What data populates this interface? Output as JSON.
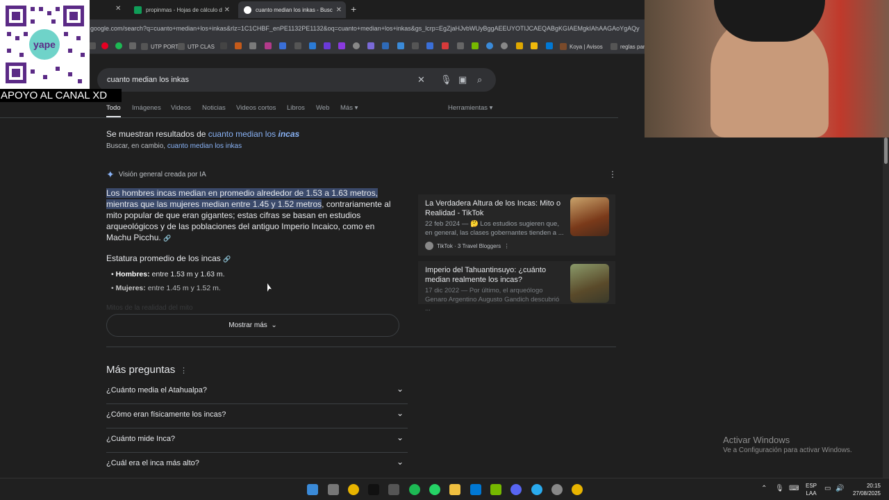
{
  "browser": {
    "tabs": [
      {
        "label": "propinmas - Hojas de cálculo d"
      },
      {
        "label": "cuanto median los inkas - Busc"
      }
    ],
    "url": "google.com/search?q=cuanto+median+los+inkas&rlz=1C1CHBF_enPE1132PE1132&oq=cuanto+median+los+inkas&gs_lcrp=EgZjaHJvbWUyBggAEEUYOTIJCAEQABgKGIAEMgkIAhAAGAoYgAQy",
    "bookmarks": [
      "UTP PORTAL",
      "UTP CLAS",
      "Koya | Avisos",
      "reglas par"
    ]
  },
  "search": {
    "query": "cuanto median los inkas"
  },
  "search_tabs": [
    "Todo",
    "Imágenes",
    "Videos",
    "Noticias",
    "Videos cortos",
    "Libros",
    "Web",
    "Más",
    "Herramientas"
  ],
  "spelling": {
    "prefix": "Se muestran resultados de ",
    "corrected": "cuanto median los ",
    "corrected_bold": "incas",
    "instead_prefix": "Buscar, en cambio, ",
    "instead_link": "cuanto median los inkas"
  },
  "ai_overview": {
    "header": "Visión general creada por IA",
    "highlight": "Los hombres incas median en promedio alrededor de 1.53 a 1.63 metros, mientras que las mujeres median entre 1.45 y 1.52 metros",
    "rest": ", contrariamente al mito popular de que eran gigantes; estas cifras se basan en estudios arqueológicos y de las poblaciones del antiguo Imperio Incaico, como en Machu Picchu.",
    "subheading": "Estatura promedio de los incas",
    "bullets": [
      {
        "label": "Hombres:",
        "text": " entre 1.53 m y 1.63 m."
      },
      {
        "label": "Mujeres:",
        "text": " entre 1.45 m y 1.52 m."
      }
    ],
    "faded": "Mitos de la realidad del mito",
    "show_more": "Mostrar más"
  },
  "sources": [
    {
      "title": "La Verdadera Altura de los Incas: Mito o Realidad - TikTok",
      "snippet": "22 feb 2024 — 🤔 Los estudios sugieren que, en general, las clases gobernantes tienden a ...",
      "site": "TikTok · 3 Travel Bloggers"
    },
    {
      "title": "Imperio del Tahuantinsuyo: ¿cuánto median realmente los incas?",
      "snippet": "17 dic 2022 — Por último, el arqueólogo Genaro Argentino Augusto Gandich descubrió ..."
    }
  ],
  "more_questions": {
    "title": "Más preguntas",
    "items": [
      "¿Cuánto media el Atahualpa?",
      "¿Cómo eran físicamente los incas?",
      "¿Cuánto mide Inca?",
      "¿Cuál era el inca más alto?"
    ]
  },
  "windows": {
    "activate_title": "Activar Windows",
    "activate_sub": "Ve a Configuración para activar Windows.",
    "lang1": "ESP",
    "lang2": "LAA",
    "time": "20:15",
    "date": "27/08/2025"
  },
  "overlay": {
    "banner": "APOYO AL CANAL XD"
  }
}
